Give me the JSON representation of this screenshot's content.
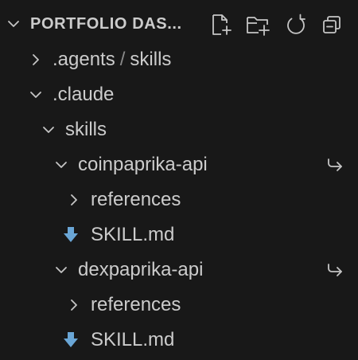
{
  "header": {
    "title": "PORTFOLIO DAS...",
    "tools": [
      "new-file-icon",
      "new-folder-icon",
      "refresh-icon",
      "collapse-all-icon"
    ]
  },
  "tree": [
    {
      "label_a": ".agents",
      "sep": "/",
      "label_b": "skills",
      "kind": "folder",
      "expanded": false
    },
    {
      "label": ".claude",
      "kind": "folder",
      "expanded": true
    },
    {
      "label": "skills",
      "kind": "folder",
      "expanded": true
    },
    {
      "label": "coinpaprika-api",
      "kind": "folder",
      "expanded": true,
      "symlink": true
    },
    {
      "label": "references",
      "kind": "folder",
      "expanded": false
    },
    {
      "label": "SKILL.md",
      "kind": "file",
      "icon": "markdown-download-icon"
    },
    {
      "label": "dexpaprika-api",
      "kind": "folder",
      "expanded": true,
      "symlink": true
    },
    {
      "label": "references",
      "kind": "folder",
      "expanded": false
    },
    {
      "label": "SKILL.md",
      "kind": "file",
      "icon": "markdown-download-icon"
    }
  ],
  "colors": {
    "background": "#181818",
    "text": "#cccccc",
    "icon": "#c5c5c5",
    "file_icon": "#6aa6d6"
  }
}
